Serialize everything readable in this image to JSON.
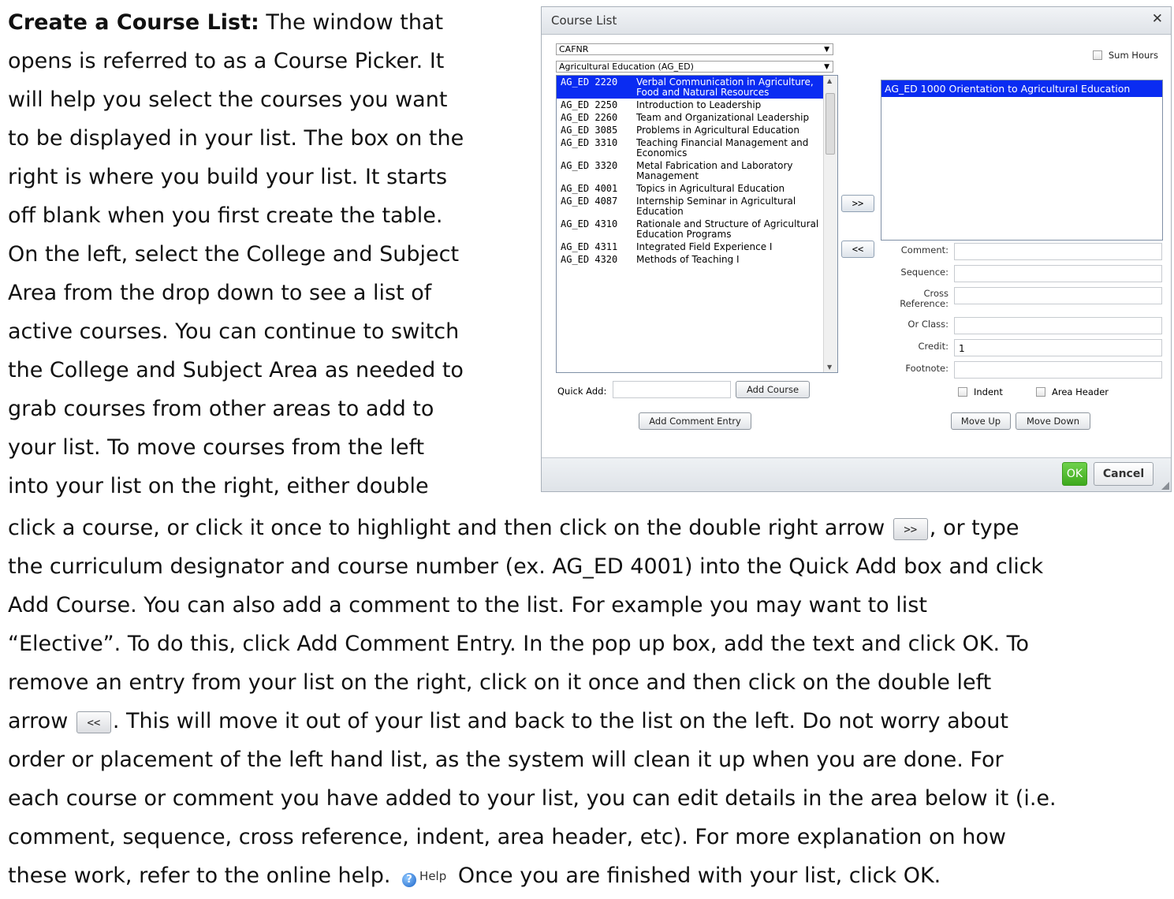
{
  "intro": {
    "heading": "Create a Course List:",
    "line1_rest": " The window that",
    "lines": [
      "opens is referred to as a Course Picker. It",
      "will help you select the courses you want",
      "to be displayed in your list.  The box on the",
      "right is where you build your list.  It starts",
      "off blank when you first create the table.",
      "On the left, select the College and Subject",
      "Area from the drop down to see a list of",
      "active courses.  You can continue to switch",
      "the College and Subject Area as needed to",
      "grab courses from other areas to add to",
      "your list. To move courses from the left",
      "into your list on the right, either double"
    ]
  },
  "lower": {
    "l1a": "click a course, or click it once to highlight and then click on the double right arrow ",
    "l1b": ", or type",
    "l2": "the curriculum designator and course number (ex. AG_ED 4001) into the Quick Add box and click",
    "l3": "Add Course.  You can also add a comment to the list.  For example you may want to list",
    "l4": "“Elective”.  To do this, click Add Comment Entry.  In the pop up box, add the text and click OK.  To",
    "l5": "remove an entry from your list on the right, click on it once and then click on the double left",
    "l6a": "arrow ",
    "l6b": ".  This will move it out of your list and back to the list on the left.  Do not worry about",
    "l7": "order or placement of the left hand list, as the system will clean it up when you are done.  For",
    "l8": "each course or comment you have added to your list, you can edit details in the area below it (i.e.",
    "l9": "comment, sequence, cross reference, indent, area header, etc). For more explanation on how",
    "l10a": "these work, refer to the online help. ",
    "l10b": " Once you are finished with your list, click OK.",
    "right_arrow_label": ">>",
    "left_arrow_label": "<<",
    "help_label": "Help"
  },
  "dialog": {
    "title": "Course List",
    "college_select": "CAFNR",
    "subject_select": "Agricultural Education (AG_ED)",
    "sum_hours_label": "Sum Hours",
    "courses": [
      {
        "code": "AG_ED 2220",
        "title": "Verbal Communication in Agriculture, Food and Natural Resources"
      },
      {
        "code": "AG_ED 2250",
        "title": "Introduction to Leadership"
      },
      {
        "code": "AG_ED 2260",
        "title": "Team and Organizational Leadership"
      },
      {
        "code": "AG_ED 3085",
        "title": "Problems in Agricultural Education"
      },
      {
        "code": "AG_ED 3310",
        "title": "Teaching Financial Management and Economics"
      },
      {
        "code": "AG_ED 3320",
        "title": "Metal Fabrication and Laboratory Management"
      },
      {
        "code": "AG_ED 4001",
        "title": "Topics in Agricultural Education"
      },
      {
        "code": "AG_ED 4087",
        "title": "Internship Seminar in Agricultural Education"
      },
      {
        "code": "AG_ED 4310",
        "title": "Rationale and Structure of Agricultural Education Programs"
      },
      {
        "code": "AG_ED 4311",
        "title": "Integrated Field Experience I"
      },
      {
        "code": "AG_ED 4320",
        "title": "Methods of Teaching I"
      }
    ],
    "move_right_label": ">>",
    "move_left_label": "<<",
    "picked_item": "AG_ED 1000  Orientation to Agricultural Education",
    "labels": {
      "comment": "Comment:",
      "sequence": "Sequence:",
      "cross_reference_1": "Cross",
      "cross_reference_2": "Reference:",
      "or_class": "Or Class:",
      "credit": "Credit:",
      "footnote": "Footnote:"
    },
    "credit_value": "1",
    "quick_add_label": "Quick Add:",
    "add_course_label": "Add Course",
    "add_comment_entry_label": "Add Comment Entry",
    "indent_label": "Indent",
    "area_header_label": "Area Header",
    "move_up_label": "Move Up",
    "move_down_label": "Move Down",
    "ok_label": "OK",
    "cancel_label": "Cancel"
  }
}
